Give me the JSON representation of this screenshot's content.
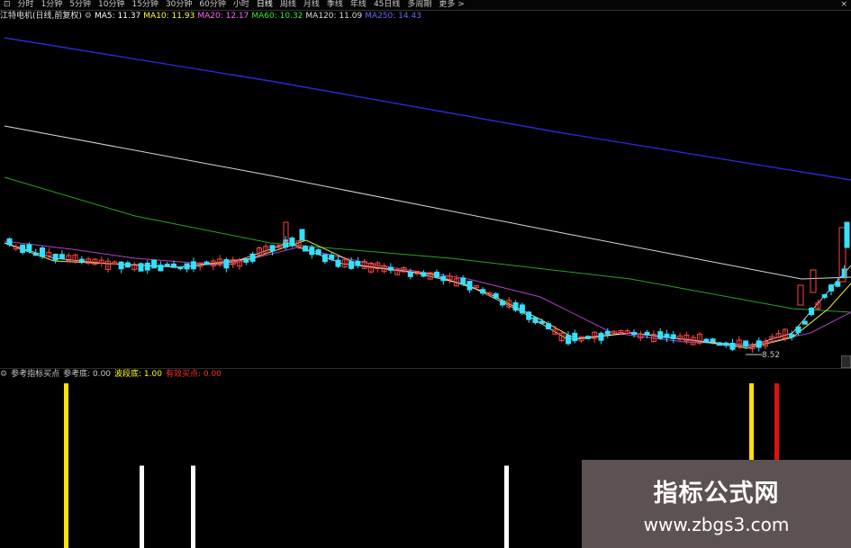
{
  "toolbar": {
    "items": [
      "分时",
      "1分钟",
      "5分钟",
      "10分钟",
      "15分钟",
      "30分钟",
      "60分钟",
      "小时",
      "日线",
      "周线",
      "月线",
      "季线",
      "年线",
      "45日线",
      "多周期",
      "更多 >"
    ],
    "first": "⊡",
    "active_index": 8,
    "close": "×"
  },
  "infobar": {
    "title": "江特电机(日线,前复权)",
    "gear_icon": "gear-icon",
    "ma5": "MA5: 11.37",
    "ma10": "MA10: 11.93",
    "ma20": "MA20: 12.17",
    "ma60": "MA60: 10.32",
    "ma120": "MA120: 11.09",
    "ma250": "MA250: 14.43",
    "colors": {
      "ma5": "#ffffff",
      "ma10": "#ffff33",
      "ma20": "#ff66ff",
      "ma60": "#33ee33",
      "ma120": "#dddddd",
      "ma250": "#4444ff"
    }
  },
  "main": {
    "low_label": "8.52",
    "colors": {
      "up": "#ff4444",
      "down": "#33e0ff",
      "ma250": "#2a2ad6",
      "ma120": "#d8d8d8",
      "ma60": "#27a327",
      "ma20": "#b240c8",
      "ma10": "#e6e64c",
      "ma5": "#f0f0f0"
    }
  },
  "indicator": {
    "name": "参考指标买点",
    "labels": [
      {
        "text": "参考底: 0.00",
        "color": "#c8c8c8"
      },
      {
        "text": "波段底: 1.00",
        "color": "#ffff00"
      },
      {
        "text": "有效买点: 0.00",
        "color": "#ff3030"
      }
    ],
    "bars": [
      {
        "kind": "yellow",
        "value": 1.0,
        "color": "#ffe000"
      },
      {
        "kind": "white",
        "value": 0.5,
        "color": "#ffffff"
      },
      {
        "kind": "white",
        "value": 0.5,
        "color": "#ffffff"
      },
      {
        "kind": "white",
        "value": 0.5,
        "color": "#ffffff"
      },
      {
        "kind": "yellow",
        "value": 1.0,
        "color": "#ffe000"
      },
      {
        "kind": "red",
        "value": 1.0,
        "color": "#e01010"
      }
    ]
  },
  "watermark": {
    "title": "指标公式网",
    "url": "www.zbgs3.com"
  }
}
